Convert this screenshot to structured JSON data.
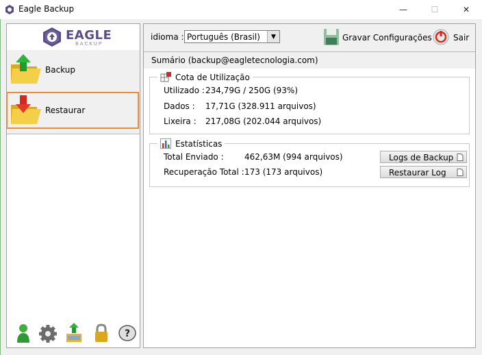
{
  "window": {
    "title": "Eagle Backup",
    "minimize": "—",
    "maximize": "☐",
    "close": "✕"
  },
  "logo": {
    "name": "EAGLE",
    "sub": "BACKUP"
  },
  "nav": [
    {
      "label": "Backup",
      "icon": "folder-upload-icon",
      "selected": false
    },
    {
      "label": "Restaurar",
      "icon": "folder-download-icon",
      "selected": true
    }
  ],
  "toolbar_icons": [
    "user-icon",
    "gear-icon",
    "transfer-icon",
    "lock-icon",
    "help-icon"
  ],
  "top_bar": {
    "lang_label": "idioma :",
    "lang_value": "Português (Brasil)",
    "save_label": "Gravar Configurações",
    "exit_label": "Sair"
  },
  "summary": {
    "label": "Sumário (backup@eagletecnologia.com)"
  },
  "quota": {
    "title": "Cota de Utilização",
    "rows": [
      {
        "key": "Utilizado :",
        "value": "234,79G / 250G (93%)"
      },
      {
        "key": "Dados :",
        "value": "17,71G  (328.911 arquivos)"
      },
      {
        "key": "Lixeira :",
        "value": "217,08G  (202.044 arquivos)"
      }
    ]
  },
  "stats": {
    "title": "Estatísticas",
    "rows": [
      {
        "key": "Total Enviado :",
        "value": "462,63M  (994 arquivos)"
      },
      {
        "key": "Recuperação Total :",
        "value": "173  (173 arquivos)"
      }
    ],
    "buttons": {
      "logs": "Logs de Backup",
      "restore_log": "Restaurar Log"
    }
  },
  "colors": {
    "accent_orange": "#f08a3a",
    "logo_purple": "#5a4d86"
  }
}
